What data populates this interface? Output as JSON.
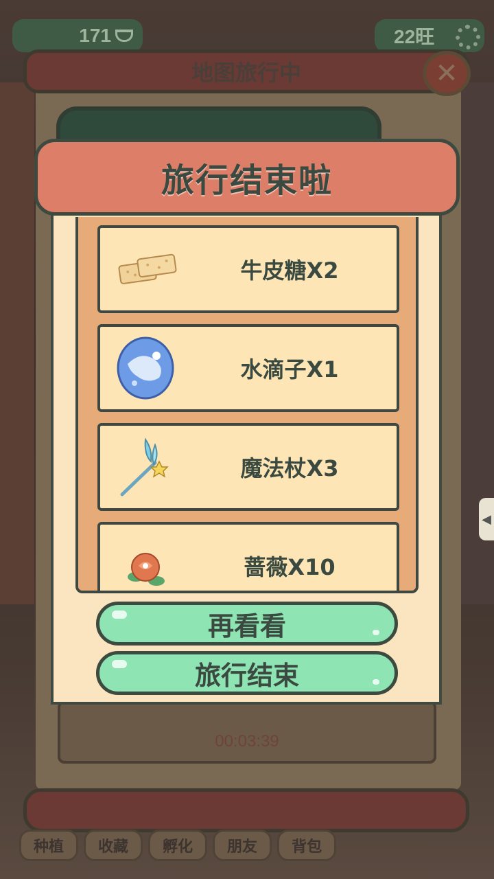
{
  "top_bar": {
    "coin_count": "171",
    "coin_icon": "ingot-icon",
    "wang_count": "22旺",
    "settings_icon": "gear-icon"
  },
  "background_panel": {
    "title": "地图旅行中",
    "close_icon": "close-icon",
    "timer": "00:03:39"
  },
  "bottom_nav": {
    "tabs": [
      {
        "label": "种植"
      },
      {
        "label": "收藏"
      },
      {
        "label": "孵化"
      },
      {
        "label": "朋友"
      },
      {
        "label": "背包"
      }
    ]
  },
  "popup": {
    "title": "旅行结束啦",
    "rewards": [
      {
        "label": "牛皮糖X2",
        "icon": "nougat-icon"
      },
      {
        "label": "水滴子X1",
        "icon": "water-orb-icon"
      },
      {
        "label": "魔法杖X3",
        "icon": "magic-wand-icon"
      },
      {
        "label": "蔷薇X10",
        "icon": "rose-icon"
      }
    ],
    "buttons": {
      "look_again": "再看看",
      "end_travel": "旅行结束"
    }
  },
  "colors": {
    "header_coral": "#dd7e69",
    "button_green": "#8ee4b3",
    "card_cream": "#fde5b5",
    "outline_dark": "#3c4a40"
  }
}
